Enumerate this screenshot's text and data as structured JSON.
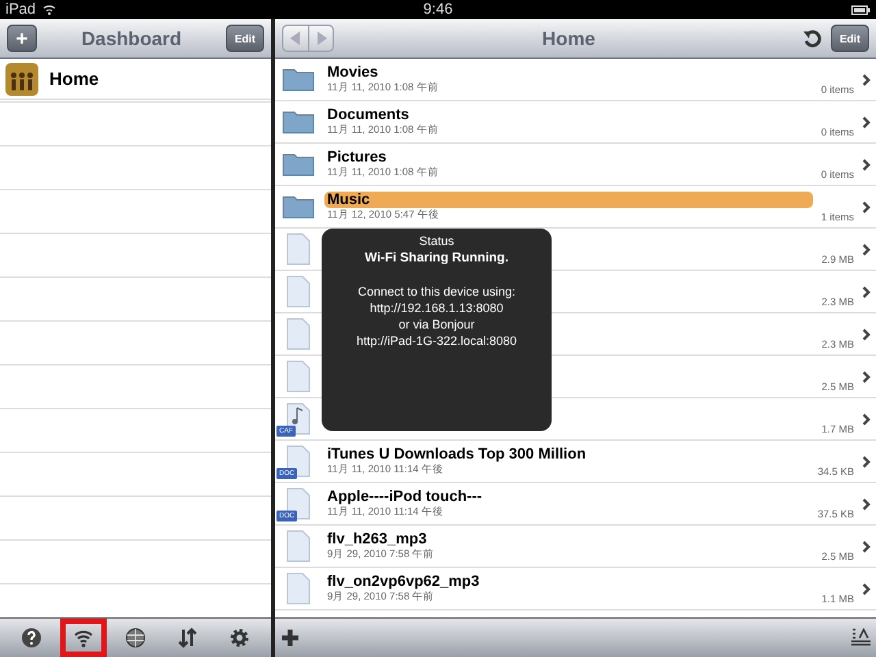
{
  "status_bar": {
    "device": "iPad",
    "time": "9:46"
  },
  "sidebar": {
    "title": "Dashboard",
    "add": "+",
    "edit": "Edit",
    "items": [
      {
        "label": "Home",
        "selected": false
      }
    ]
  },
  "sidebar_toolbar": [
    {
      "kind": "help",
      "highlighted": false
    },
    {
      "kind": "wifi",
      "highlighted": true
    },
    {
      "kind": "globe",
      "highlighted": false
    },
    {
      "kind": "sort",
      "highlighted": false
    },
    {
      "kind": "settings",
      "highlighted": false
    }
  ],
  "browser": {
    "title": "Home",
    "edit": "Edit",
    "files": [
      {
        "kind": "folder",
        "name": "Movies",
        "date": "11月 11, 2010 1:08 午前",
        "size": "0 items",
        "selected": false
      },
      {
        "kind": "folder",
        "name": "Documents",
        "date": "11月 11, 2010 1:08 午前",
        "size": "0 items",
        "selected": false
      },
      {
        "kind": "folder",
        "name": "Pictures",
        "date": "11月 11, 2010 1:08 午前",
        "size": "0 items",
        "selected": false
      },
      {
        "kind": "folder",
        "name": "Music",
        "date": "11月 12, 2010 5:47 午後",
        "size": "1 items",
        "selected": true
      },
      {
        "kind": "file",
        "size": "2.9 MB",
        "selected": false
      },
      {
        "kind": "file",
        "size": "2.3 MB",
        "selected": false
      },
      {
        "kind": "file",
        "size": "2.3 MB",
        "selected": false
      },
      {
        "kind": "file",
        "size": "2.5 MB",
        "selected": false
      },
      {
        "kind": "audio",
        "badge": "CAF",
        "size": "1.7 MB",
        "selected": false
      },
      {
        "kind": "doc",
        "name": "iTunes U Downloads Top 300 Million",
        "badge": "DOC",
        "date": "11月 11, 2010 11:14 午後",
        "size": "34.5 KB",
        "selected": false
      },
      {
        "kind": "doc",
        "name": "Apple----iPod touch---",
        "badge": "DOC",
        "date": "11月 11, 2010 11:14 午後",
        "size": "37.5 KB",
        "selected": false
      },
      {
        "kind": "file",
        "name": "flv_h263_mp3",
        "date": "9月 29, 2010 7:58 午前",
        "size": "2.5 MB",
        "selected": false
      },
      {
        "kind": "file",
        "name": "flv_on2vp6vp62_mp3",
        "date": "9月 29, 2010 7:58 午前",
        "size": "1.1 MB",
        "selected": false
      }
    ]
  },
  "status_popup": {
    "title": "Status",
    "headline": "Wi-Fi Sharing Running.",
    "lines": [
      "Connect to this device using:",
      "http://192.168.1.13:8080",
      "or via Bonjour",
      "http://iPad-1G-322.local:8080"
    ]
  }
}
